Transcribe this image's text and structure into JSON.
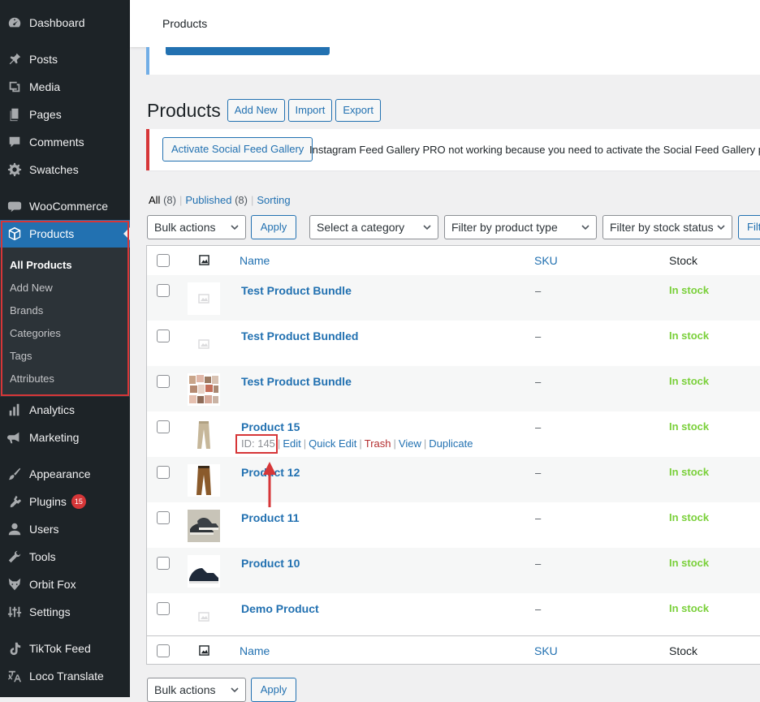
{
  "sidebar": {
    "items": [
      {
        "label": "Dashboard",
        "icon": "dashboard-icon"
      },
      {
        "label": "Posts",
        "icon": "pin-icon"
      },
      {
        "label": "Media",
        "icon": "media-icon"
      },
      {
        "label": "Pages",
        "icon": "pages-icon"
      },
      {
        "label": "Comments",
        "icon": "comment-icon"
      },
      {
        "label": "Swatches",
        "icon": "gear-icon"
      },
      {
        "label": "WooCommerce",
        "icon": "woo-icon"
      },
      {
        "label": "Products",
        "icon": "box-icon"
      },
      {
        "label": "Analytics",
        "icon": "bar-chart-icon"
      },
      {
        "label": "Marketing",
        "icon": "megaphone-icon"
      },
      {
        "label": "Appearance",
        "icon": "brush-icon"
      },
      {
        "label": "Plugins",
        "icon": "plugin-icon",
        "badge": "15"
      },
      {
        "label": "Users",
        "icon": "user-icon"
      },
      {
        "label": "Tools",
        "icon": "wrench-icon"
      },
      {
        "label": "Orbit Fox",
        "icon": "fox-icon"
      },
      {
        "label": "Settings",
        "icon": "settings-icon"
      },
      {
        "label": "TikTok Feed",
        "icon": "tiktok-icon"
      },
      {
        "label": "Loco Translate",
        "icon": "translate-icon"
      }
    ],
    "submenu": [
      "All Products",
      "Add New",
      "Brands",
      "Categories",
      "Tags",
      "Attributes"
    ]
  },
  "topbar": {
    "title": "Products"
  },
  "heading": {
    "title": "Products",
    "add_new": "Add New",
    "import": "Import",
    "export": "Export"
  },
  "notice": {
    "button": "Activate Social Feed Gallery",
    "text": "Instagram Feed Gallery PRO not working because you need to activate the Social Feed Gallery plugin."
  },
  "views": {
    "all": "All",
    "all_count": "(8)",
    "published": "Published",
    "published_count": "(8)",
    "sorting": "Sorting",
    "sep": "|"
  },
  "filters": {
    "bulk_actions": "Bulk actions",
    "apply": "Apply",
    "category": "Select a category",
    "product_type": "Filter by product type",
    "stock_status": "Filter by stock status",
    "filter": "Filter"
  },
  "table": {
    "columns": {
      "name": "Name",
      "sku": "SKU",
      "stock": "Stock"
    },
    "rows": [
      {
        "name": "Test Product Bundle",
        "sku": "–",
        "stock": "In stock",
        "thumb": "placeholder"
      },
      {
        "name": "Test Product Bundled",
        "sku": "–",
        "stock": "In stock",
        "thumb": "placeholder"
      },
      {
        "name": "Test Product Bundle",
        "sku": "–",
        "stock": "In stock",
        "thumb": "collage"
      },
      {
        "name": "Product 15",
        "sku": "–",
        "stock": "In stock",
        "thumb": "khaki-pants"
      },
      {
        "name": "Product 12",
        "sku": "–",
        "stock": "In stock",
        "thumb": "brown-pants"
      },
      {
        "name": "Product 11",
        "sku": "–",
        "stock": "In stock",
        "thumb": "sneakers"
      },
      {
        "name": "Product 10",
        "sku": "–",
        "stock": "In stock",
        "thumb": "dark-shoe"
      },
      {
        "name": "Demo Product",
        "sku": "–",
        "stock": "In stock",
        "thumb": "placeholder"
      }
    ],
    "row_actions": {
      "id": "ID: 145",
      "edit": "Edit",
      "quick_edit": "Quick Edit",
      "trash": "Trash",
      "view": "View",
      "duplicate": "Duplicate",
      "sep": "|"
    }
  },
  "bottom": {
    "bulk_actions": "Bulk actions",
    "apply": "Apply"
  },
  "colors": {
    "accent": "#2271b1",
    "sidebar": "#1d2327",
    "in_stock": "#7ad03a",
    "annotation": "#d63638"
  }
}
